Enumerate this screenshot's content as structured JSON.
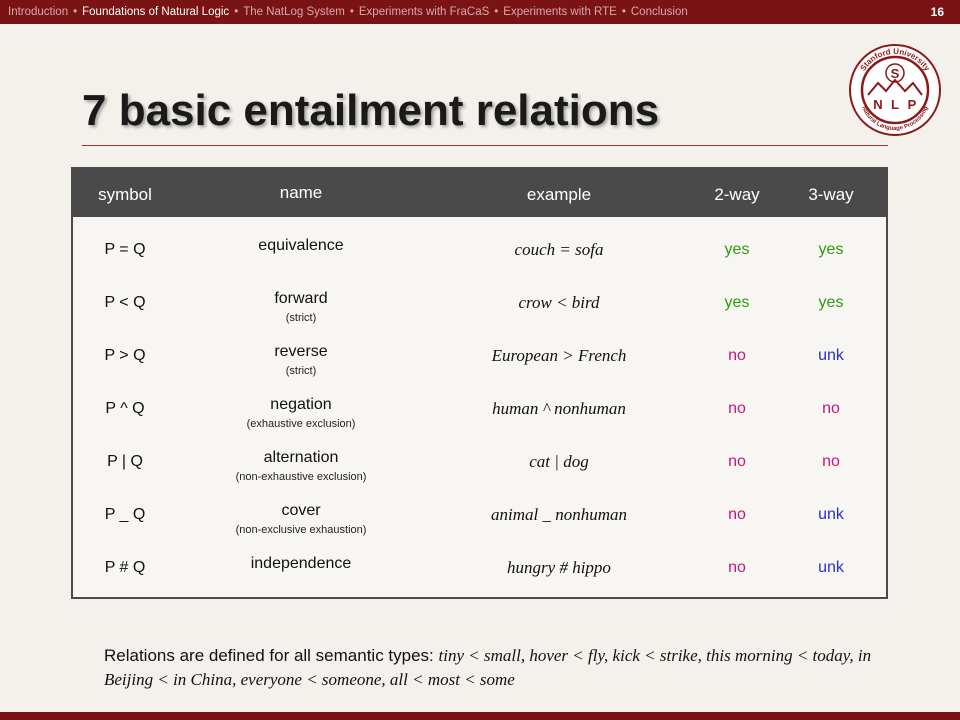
{
  "nav": {
    "items": [
      {
        "label": "Introduction",
        "active": false
      },
      {
        "label": "Foundations of Natural Logic",
        "active": true
      },
      {
        "label": "The NatLog System",
        "active": false
      },
      {
        "label": "Experiments with FraCaS",
        "active": false
      },
      {
        "label": "Experiments with RTE",
        "active": false
      },
      {
        "label": "Conclusion",
        "active": false
      }
    ],
    "separator": "•",
    "page_number": "16"
  },
  "logo": {
    "top_text": "Stanford University",
    "bottom_text": "Natural Language Processing",
    "letters": [
      "S",
      "N",
      "L",
      "P"
    ]
  },
  "title": "7 basic entailment relations",
  "table": {
    "headers": {
      "symbol": "symbol",
      "name": "name",
      "example": "example",
      "two_way": "2-way",
      "three_way": "3-way"
    },
    "rows": [
      {
        "symbol": "P = Q",
        "name": "equivalence",
        "sub": "",
        "example": "couch = sofa",
        "two_way": "yes",
        "three_way": "yes"
      },
      {
        "symbol": "P < Q",
        "name": "forward",
        "sub": "(strict)",
        "example": "crow < bird",
        "two_way": "yes",
        "three_way": "yes"
      },
      {
        "symbol": "P > Q",
        "name": "reverse",
        "sub": "(strict)",
        "example": "European > French",
        "two_way": "no",
        "three_way": "unk"
      },
      {
        "symbol": "P ^ Q",
        "name": "negation",
        "sub": "(exhaustive exclusion)",
        "example": "human ^ nonhuman",
        "two_way": "no",
        "three_way": "no"
      },
      {
        "symbol": "P | Q",
        "name": "alternation",
        "sub": "(non-exhaustive exclusion)",
        "example": "cat | dog",
        "two_way": "no",
        "three_way": "no"
      },
      {
        "symbol": "P _ Q",
        "name": "cover",
        "sub": "(non-exclusive exhaustion)",
        "example": "animal _ nonhuman",
        "two_way": "no",
        "three_way": "unk"
      },
      {
        "symbol": "P # Q",
        "name": "independence",
        "sub": "",
        "example": "hungry # hippo",
        "two_way": "no",
        "three_way": "unk"
      }
    ]
  },
  "colors": {
    "yes": "#2e9a12",
    "no": "#c8157a",
    "unk": "#2233c8",
    "accent": "#7a1414"
  },
  "footer": {
    "lead": "Relations are defined for all semantic types: ",
    "examples": "tiny < small, hover < fly, kick < strike, this morning < today, in Beijing < in China, everyone < someone, all < most < some"
  }
}
